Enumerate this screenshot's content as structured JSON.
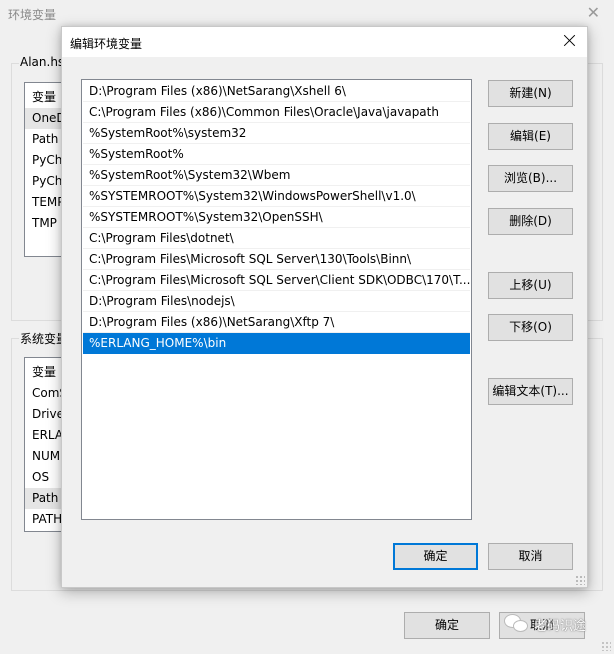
{
  "background_window": {
    "title": "环境变量",
    "user_group_label": "Alan.hsi",
    "user_list": {
      "header": "变量",
      "rows": [
        "OneD",
        "Path",
        "PyCha",
        "PyCha",
        "TEMP",
        "TMP"
      ],
      "selected_index": 0
    },
    "system_group_label": "系统变量",
    "system_list": {
      "header": "变量",
      "rows": [
        "ComS",
        "Drive",
        "ERLA",
        "NUM",
        "OS",
        "Path",
        "PATH"
      ],
      "selected_index": 5
    },
    "ok_label": "确定",
    "cancel_label": "取消"
  },
  "dialog": {
    "title": "编辑环境变量",
    "paths": [
      "D:\\Program Files (x86)\\NetSarang\\Xshell 6\\",
      "C:\\Program Files (x86)\\Common Files\\Oracle\\Java\\javapath",
      "%SystemRoot%\\system32",
      "%SystemRoot%",
      "%SystemRoot%\\System32\\Wbem",
      "%SYSTEMROOT%\\System32\\WindowsPowerShell\\v1.0\\",
      "%SYSTEMROOT%\\System32\\OpenSSH\\",
      "C:\\Program Files\\dotnet\\",
      "C:\\Program Files\\Microsoft SQL Server\\130\\Tools\\Binn\\",
      "C:\\Program Files\\Microsoft SQL Server\\Client SDK\\ODBC\\170\\T...",
      "D:\\Program Files\\nodejs\\",
      "D:\\Program Files (x86)\\NetSarang\\Xftp 7\\",
      "%ERLANG_HOME%\\bin"
    ],
    "selected_index": 12,
    "buttons": {
      "new": "新建(N)",
      "edit": "编辑(E)",
      "browse": "浏览(B)...",
      "delete": "删除(D)",
      "move_up": "上移(U)",
      "move_down": "下移(O)",
      "edit_text": "编辑文本(T)...",
      "ok": "确定",
      "cancel": "取消"
    },
    "colors": {
      "selection": "#0078d7",
      "default_button_border": "#0078d7"
    }
  },
  "watermark": {
    "icon": "wechat-icon",
    "text": "老码识途"
  }
}
